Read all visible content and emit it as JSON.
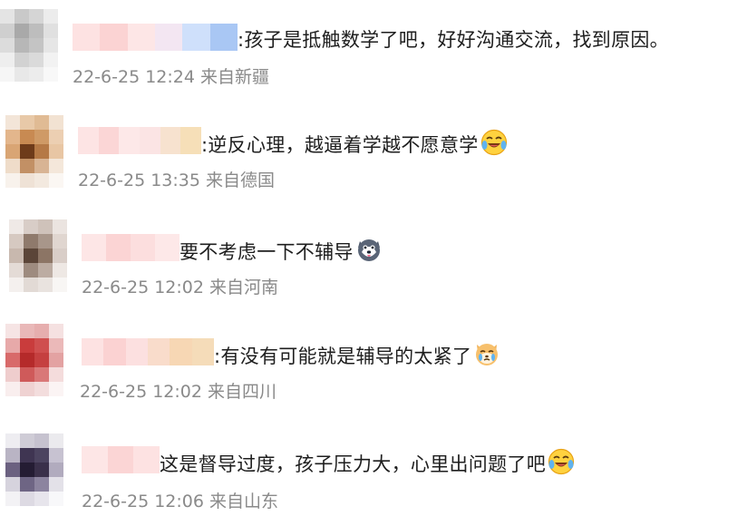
{
  "comments": [
    {
      "text": ":孩子是抵触数学了吧，好好沟通交流，找到原因。",
      "date": "22-6-25 12:24",
      "location": "来自新疆",
      "emoji": ""
    },
    {
      "text": ":逆反心理，越逼着学越不愿意学",
      "date": "22-6-25 13:35",
      "location": "来自德国",
      "emoji": "laugh-cry-emoji"
    },
    {
      "text": "要不考虑一下不辅导",
      "date": "22-6-25 12:02",
      "location": "来自河南",
      "emoji": "husky-emoji"
    },
    {
      "text": ":有没有可能就是辅导的太紧了",
      "date": "22-6-25 12:02",
      "location": "来自四川",
      "emoji": "crying-dog-emoji"
    },
    {
      "text": "这是督导过度，孩子压力大，心里出问题了吧",
      "date": "22-6-25 12:06",
      "location": "来自山东",
      "emoji": "laugh-cry-emoji"
    }
  ],
  "colors": {
    "text": "#1e1e1e",
    "meta": "#8a8a8a",
    "blur_pink": "#fbd3d3"
  }
}
